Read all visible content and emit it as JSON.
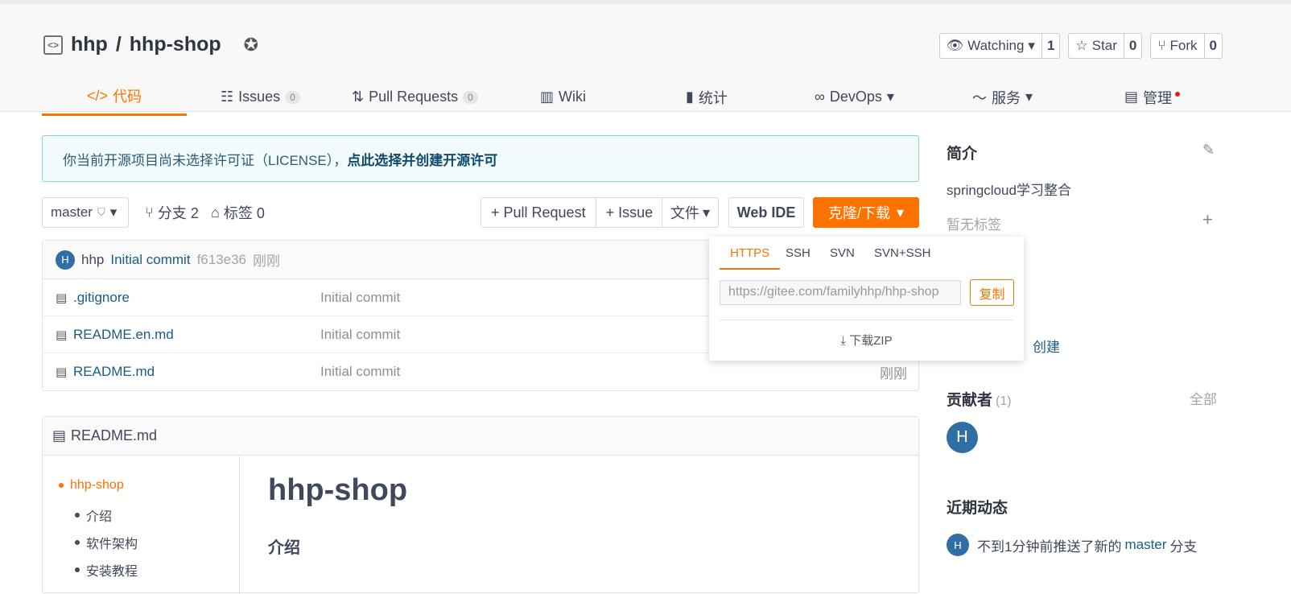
{
  "repo": {
    "owner": "hhp",
    "sep": "/",
    "name": "hhp-shop"
  },
  "actions": {
    "watch": {
      "label": "Watching",
      "count": "1"
    },
    "star": {
      "label": "Star",
      "count": "0"
    },
    "fork": {
      "label": "Fork",
      "count": "0"
    }
  },
  "tabs": [
    {
      "label": "代码"
    },
    {
      "label": "Issues",
      "badge": "0"
    },
    {
      "label": "Pull Requests",
      "badge": "0"
    },
    {
      "label": "Wiki"
    },
    {
      "label": "统计"
    },
    {
      "label": "DevOps"
    },
    {
      "label": "服务"
    },
    {
      "label": "管理"
    }
  ],
  "notice": {
    "text": "你当前开源项目尚未选择许可证（LICENSE），",
    "link": "点此选择并创建开源许可"
  },
  "toolbar": {
    "branch": "master",
    "branches": "分支 2",
    "tags": "标签 0",
    "pull_request": "+ Pull Request",
    "issue": "+ Issue",
    "file": "文件",
    "web_ide": "Web IDE",
    "clone": "克隆/下载"
  },
  "commit": {
    "avatar": "H",
    "author": "hhp",
    "message": "Initial commit",
    "hash": "f613e36",
    "time": "刚刚"
  },
  "files": [
    {
      "name": ".gitignore",
      "message": "Initial commit",
      "time": ""
    },
    {
      "name": "README.en.md",
      "message": "Initial commit",
      "time": ""
    },
    {
      "name": "README.md",
      "message": "Initial commit",
      "time": "刚刚"
    }
  ],
  "readme": {
    "filename": "README.md",
    "toc": [
      "hhp-shop",
      "介绍",
      "软件架构",
      "安装教程"
    ],
    "h1": "hhp-shop",
    "h2": "介绍"
  },
  "clone_popup": {
    "tabs": [
      "HTTPS",
      "SSH",
      "SVN",
      "SVN+SSH"
    ],
    "url": "https://gitee.com/familyhhp/hhp-shop",
    "copy": "复制",
    "download_zip": "下载ZIP"
  },
  "sidebar": {
    "intro_title": "简介",
    "description": "springcloud学习整合",
    "no_tags": "暂无标签",
    "create_link": "创建",
    "contributors_title": "贡献者",
    "contributors_count": "(1)",
    "contributors_all": "全部",
    "contributor_avatar": "H",
    "activity_title": "近期动态",
    "activity_avatar": "H",
    "activity_text": "不到1分钟前推送了新的",
    "activity_branch": "master",
    "activity_suffix": "分支"
  },
  "colors": {
    "accent": "#fe7300",
    "link": "#1b5c86",
    "avatar": "#2f6fa6"
  }
}
